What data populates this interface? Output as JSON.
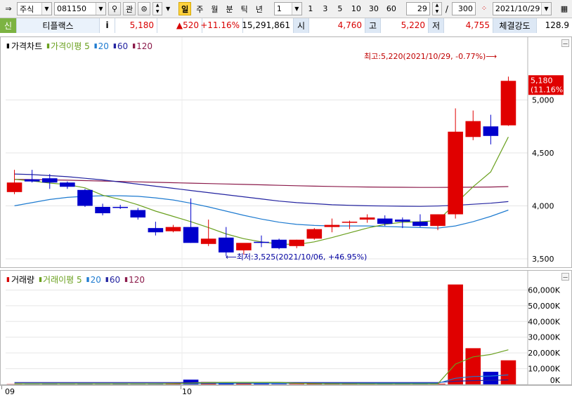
{
  "toolbar": {
    "market": "주식",
    "code": "081150",
    "search_icon": "magnifier-icon",
    "kwan_label": "관",
    "period_buttons": [
      "일",
      "주",
      "월",
      "분",
      "틱",
      "년"
    ],
    "active_period": "일",
    "unit_value": "1",
    "quick_buttons": [
      "1",
      "3",
      "5",
      "10",
      "30",
      "60"
    ],
    "count_value": "29",
    "slash": "/",
    "total_value": "300",
    "date_value": "2021/10/29"
  },
  "infobar": {
    "sin_label": "신",
    "name": "티플랙스",
    "info_icon": "i",
    "price": "5,180",
    "change": "▲520",
    "change_pct": "+11.16%",
    "volume": "15,291,861",
    "open_label": "시",
    "open": "4,760",
    "high_label": "고",
    "high": "5,220",
    "low_label": "저",
    "low": "4,755",
    "strength_label": "체결강도",
    "strength": "128.9"
  },
  "price_legend": {
    "title": "가격차트",
    "ma_label": "가격이평",
    "ma_periods": [
      "5",
      "20",
      "60",
      "120"
    ],
    "colors": [
      "#6aa01e",
      "#1e7bd0",
      "#2323a0",
      "#8b1a4a"
    ]
  },
  "volume_legend": {
    "title": "거래량",
    "ma_label": "거래이평",
    "ma_periods": [
      "5",
      "20",
      "60",
      "120"
    ]
  },
  "annotations": {
    "high": "최고:5,220(2021/10/29, -0.77%)⟶",
    "low": "⟵최저:3,525(2021/10/06, +46.95%)",
    "last_price": "5,180",
    "last_pct": "(11.16%)"
  },
  "x_labels": [
    "09",
    "10"
  ],
  "chart_data": {
    "type": "candlestick",
    "price_axis": {
      "ticks": [
        "5,000",
        "4,500",
        "4,000",
        "3,500"
      ],
      "values": [
        5000,
        4500,
        4000,
        3500
      ],
      "ylim": [
        3440,
        5460
      ]
    },
    "volume_axis": {
      "ticks": [
        "60,000K",
        "50,000K",
        "40,000K",
        "30,000K",
        "20,000K",
        "10,000K",
        "0K"
      ],
      "values": [
        60000,
        50000,
        40000,
        30000,
        20000,
        10000,
        0
      ],
      "ylim": [
        0,
        66000
      ]
    },
    "candles": [
      {
        "o": 4130,
        "h": 4340,
        "l": 4110,
        "c": 4220
      },
      {
        "o": 4250,
        "h": 4340,
        "l": 4220,
        "c": 4230
      },
      {
        "o": 4260,
        "h": 4300,
        "l": 4160,
        "c": 4220
      },
      {
        "o": 4220,
        "h": 4230,
        "l": 4160,
        "c": 4180
      },
      {
        "o": 4150,
        "h": 4160,
        "l": 3990,
        "c": 4000
      },
      {
        "o": 3990,
        "h": 4020,
        "l": 3910,
        "c": 3930
      },
      {
        "o": 3990,
        "h": 4010,
        "l": 3970,
        "c": 3980
      },
      {
        "o": 3960,
        "h": 3980,
        "l": 3870,
        "c": 3890
      },
      {
        "o": 3790,
        "h": 3850,
        "l": 3720,
        "c": 3750
      },
      {
        "o": 3760,
        "h": 3820,
        "l": 3750,
        "c": 3800
      },
      {
        "o": 3800,
        "h": 4070,
        "l": 3650,
        "c": 3650
      },
      {
        "o": 3640,
        "h": 3870,
        "l": 3620,
        "c": 3690
      },
      {
        "o": 3700,
        "h": 3800,
        "l": 3525,
        "c": 3560
      },
      {
        "o": 3580,
        "h": 3620,
        "l": 3540,
        "c": 3650
      },
      {
        "o": 3660,
        "h": 3720,
        "l": 3610,
        "c": 3650
      },
      {
        "o": 3680,
        "h": 3690,
        "l": 3590,
        "c": 3600
      },
      {
        "o": 3620,
        "h": 3680,
        "l": 3600,
        "c": 3680
      },
      {
        "o": 3690,
        "h": 3790,
        "l": 3680,
        "c": 3780
      },
      {
        "o": 3800,
        "h": 3880,
        "l": 3750,
        "c": 3820
      },
      {
        "o": 3840,
        "h": 3860,
        "l": 3780,
        "c": 3850
      },
      {
        "o": 3870,
        "h": 3920,
        "l": 3840,
        "c": 3890
      },
      {
        "o": 3880,
        "h": 3910,
        "l": 3810,
        "c": 3830
      },
      {
        "o": 3870,
        "h": 3890,
        "l": 3790,
        "c": 3850
      },
      {
        "o": 3850,
        "h": 3920,
        "l": 3800,
        "c": 3810
      },
      {
        "o": 3810,
        "h": 3920,
        "l": 3770,
        "c": 3920
      },
      {
        "o": 3920,
        "h": 4920,
        "l": 3880,
        "c": 4700
      },
      {
        "o": 4650,
        "h": 4900,
        "l": 4620,
        "c": 4800
      },
      {
        "o": 4750,
        "h": 4860,
        "l": 4580,
        "c": 4660
      },
      {
        "o": 4760,
        "h": 5220,
        "l": 4755,
        "c": 5180
      }
    ],
    "volume": [
      150,
      120,
      200,
      150,
      250,
      150,
      250,
      150,
      200,
      600,
      3000,
      1500,
      1000,
      600,
      400,
      300,
      300,
      400,
      300,
      300,
      300,
      300,
      300,
      300,
      400,
      63500,
      23000,
      8000,
      15300
    ],
    "ma5": [
      4250,
      4235,
      4215,
      4200,
      4170,
      4100,
      4060,
      4010,
      3950,
      3900,
      3850,
      3795,
      3735,
      3690,
      3660,
      3640,
      3635,
      3660,
      3700,
      3745,
      3790,
      3825,
      3845,
      3850,
      3860,
      4020,
      4180,
      4320,
      4650
    ],
    "ma20": [
      4000,
      4030,
      4060,
      4080,
      4090,
      4095,
      4095,
      4090,
      4075,
      4055,
      4025,
      3990,
      3950,
      3910,
      3875,
      3845,
      3825,
      3815,
      3810,
      3810,
      3810,
      3805,
      3800,
      3795,
      3790,
      3810,
      3850,
      3900,
      3960
    ],
    "ma60": [
      4300,
      4295,
      4285,
      4275,
      4260,
      4245,
      4225,
      4205,
      4185,
      4165,
      4145,
      4125,
      4105,
      4085,
      4065,
      4045,
      4030,
      4020,
      4010,
      4005,
      4000,
      3998,
      3996,
      3995,
      3998,
      4005,
      4015,
      4025,
      4040
    ],
    "ma120": [
      4250,
      4248,
      4245,
      4242,
      4238,
      4234,
      4230,
      4226,
      4222,
      4218,
      4214,
      4210,
      4206,
      4202,
      4198,
      4194,
      4190,
      4186,
      4183,
      4180,
      4178,
      4176,
      4175,
      4174,
      4174,
      4175,
      4176,
      4178,
      4182
    ],
    "vol_ma5": [
      400,
      400,
      400,
      400,
      400,
      400,
      400,
      400,
      400,
      500,
      800,
      1200,
      1300,
      1300,
      1300,
      1300,
      700,
      500,
      400,
      350,
      330,
      320,
      300,
      300,
      320,
      12900,
      17500,
      19000,
      22000
    ],
    "vol_ma20": [
      500,
      500,
      500,
      500,
      500,
      500,
      500,
      500,
      500,
      520,
      600,
      650,
      700,
      700,
      720,
      720,
      720,
      720,
      720,
      720,
      720,
      720,
      720,
      720,
      720,
      3900,
      5000,
      5300,
      6000
    ],
    "vol_ma60": [
      1200,
      1200,
      1200,
      1200,
      1200,
      1200,
      1200,
      1200,
      1200,
      1200,
      1200,
      1200,
      1200,
      1200,
      1200,
      1200,
      1200,
      1200,
      1200,
      1200,
      1200,
      1200,
      1200,
      1200,
      1200,
      2000,
      2400,
      2600,
      2800
    ]
  }
}
